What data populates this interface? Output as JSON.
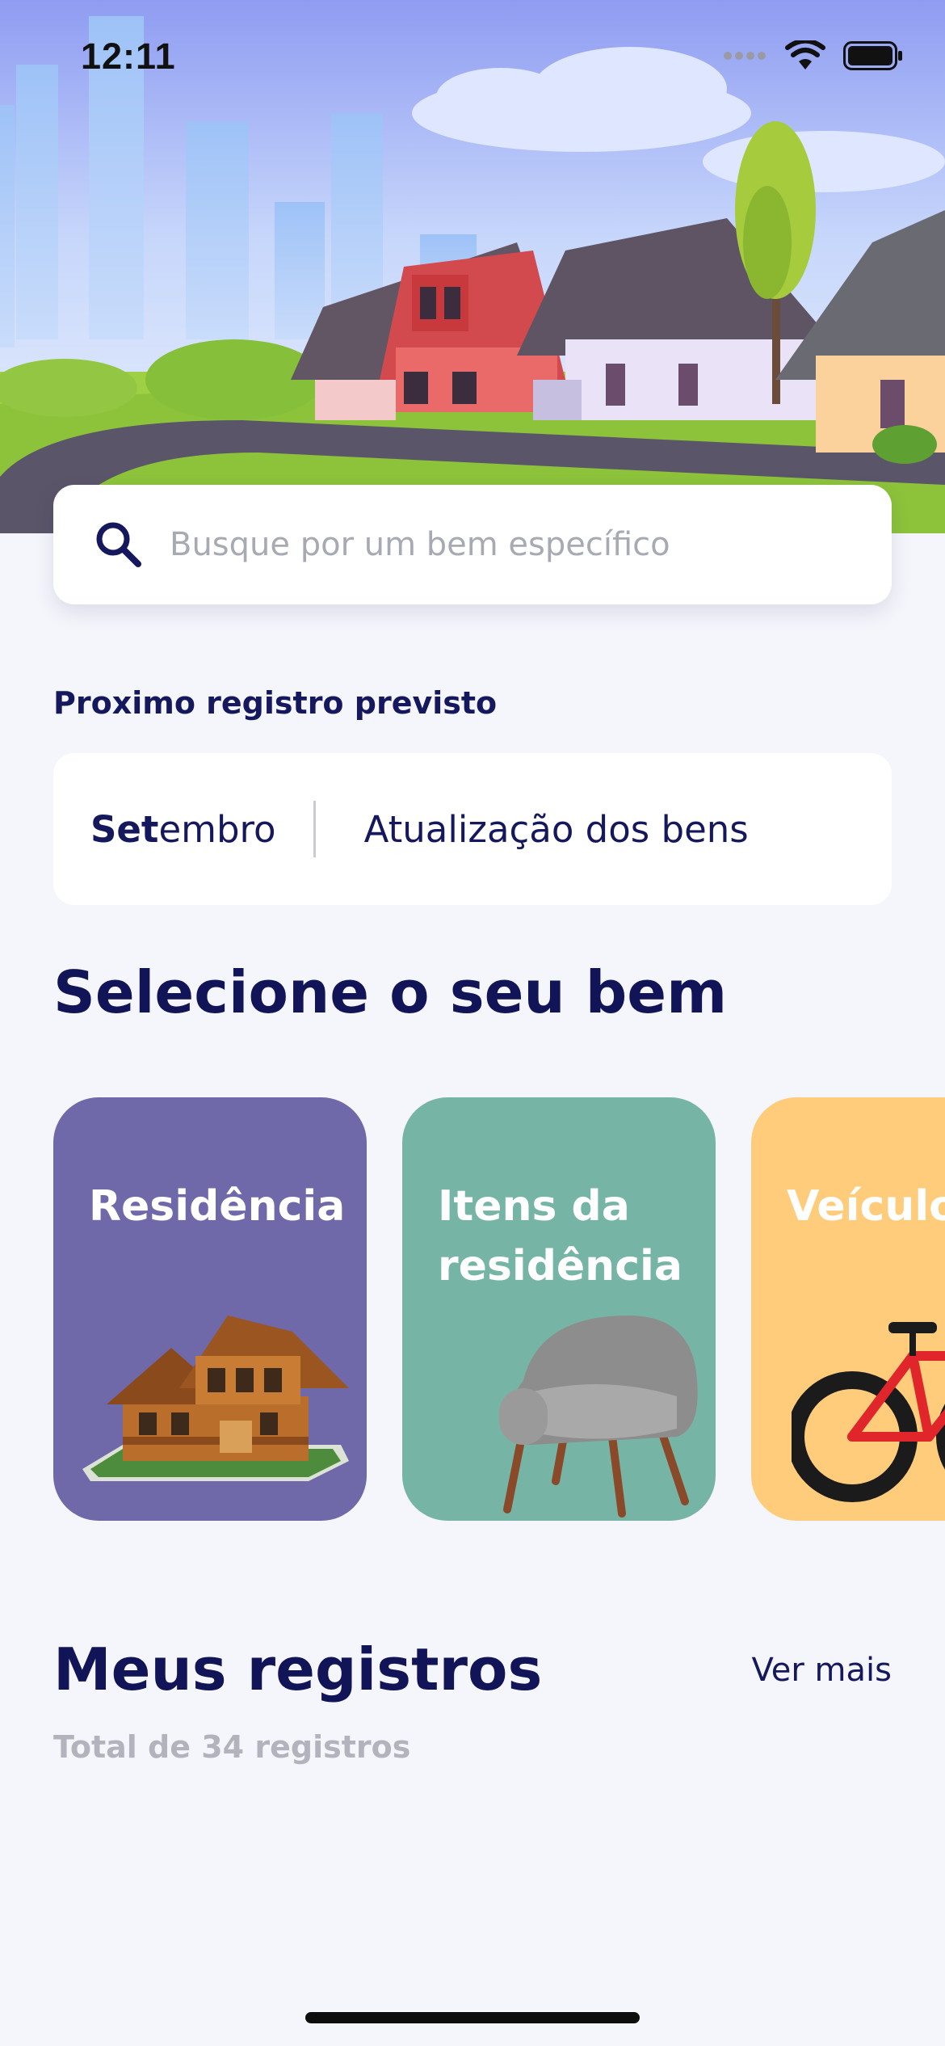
{
  "status_bar": {
    "time": "12:11"
  },
  "search": {
    "placeholder": "Busque por um bem específico"
  },
  "next_register": {
    "label": "Proximo registro previsto",
    "month_bold": "Set",
    "month_rest": "embro",
    "description": "Atualização dos bens"
  },
  "select": {
    "title": "Selecione o seu bem",
    "categories": [
      {
        "label": "Residência",
        "color": "#6f69a9",
        "icon": "house-icon"
      },
      {
        "label": "Itens da residência",
        "color": "#76b5a6",
        "icon": "armchair-icon"
      },
      {
        "label": "Veículos",
        "color": "#fecc7b",
        "icon": "bicycle-icon"
      }
    ]
  },
  "registros": {
    "title": "Meus registros",
    "see_more": "Ver mais",
    "subtitle": "Total de 34 registros"
  }
}
